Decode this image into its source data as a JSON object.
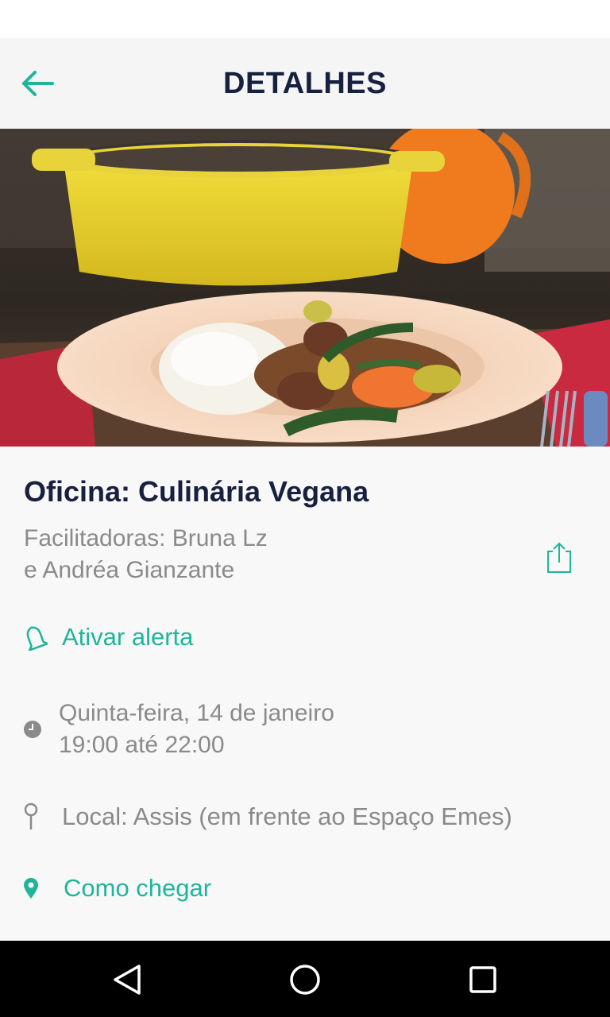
{
  "app_bar": {
    "title": "DETALHES",
    "back_icon": "arrow-left-icon"
  },
  "colors": {
    "accent": "#1fb59a",
    "title": "#17213f",
    "muted": "#8a8a8a"
  },
  "event": {
    "title": "Oficina: Culinária Vegana",
    "facilitators_line1": "Facilitadoras: Bruna Lz",
    "facilitators_line2": "e Andréa Gianzante",
    "share_icon": "share-icon"
  },
  "alert": {
    "label": "Ativar alerta",
    "icon": "bell-icon"
  },
  "schedule": {
    "date": "Quinta-feira, 14 de janeiro",
    "time": "19:00 até 22:00",
    "icon": "clock-icon"
  },
  "location": {
    "label": "Local: Assis (em frente ao Espaço Emes)",
    "icon": "pin-outline-icon"
  },
  "directions": {
    "label": "Como chegar",
    "icon": "map-marker-icon"
  },
  "nav": {
    "back_icon": "nav-back-icon",
    "home_icon": "nav-home-icon",
    "recents_icon": "nav-recents-icon"
  }
}
